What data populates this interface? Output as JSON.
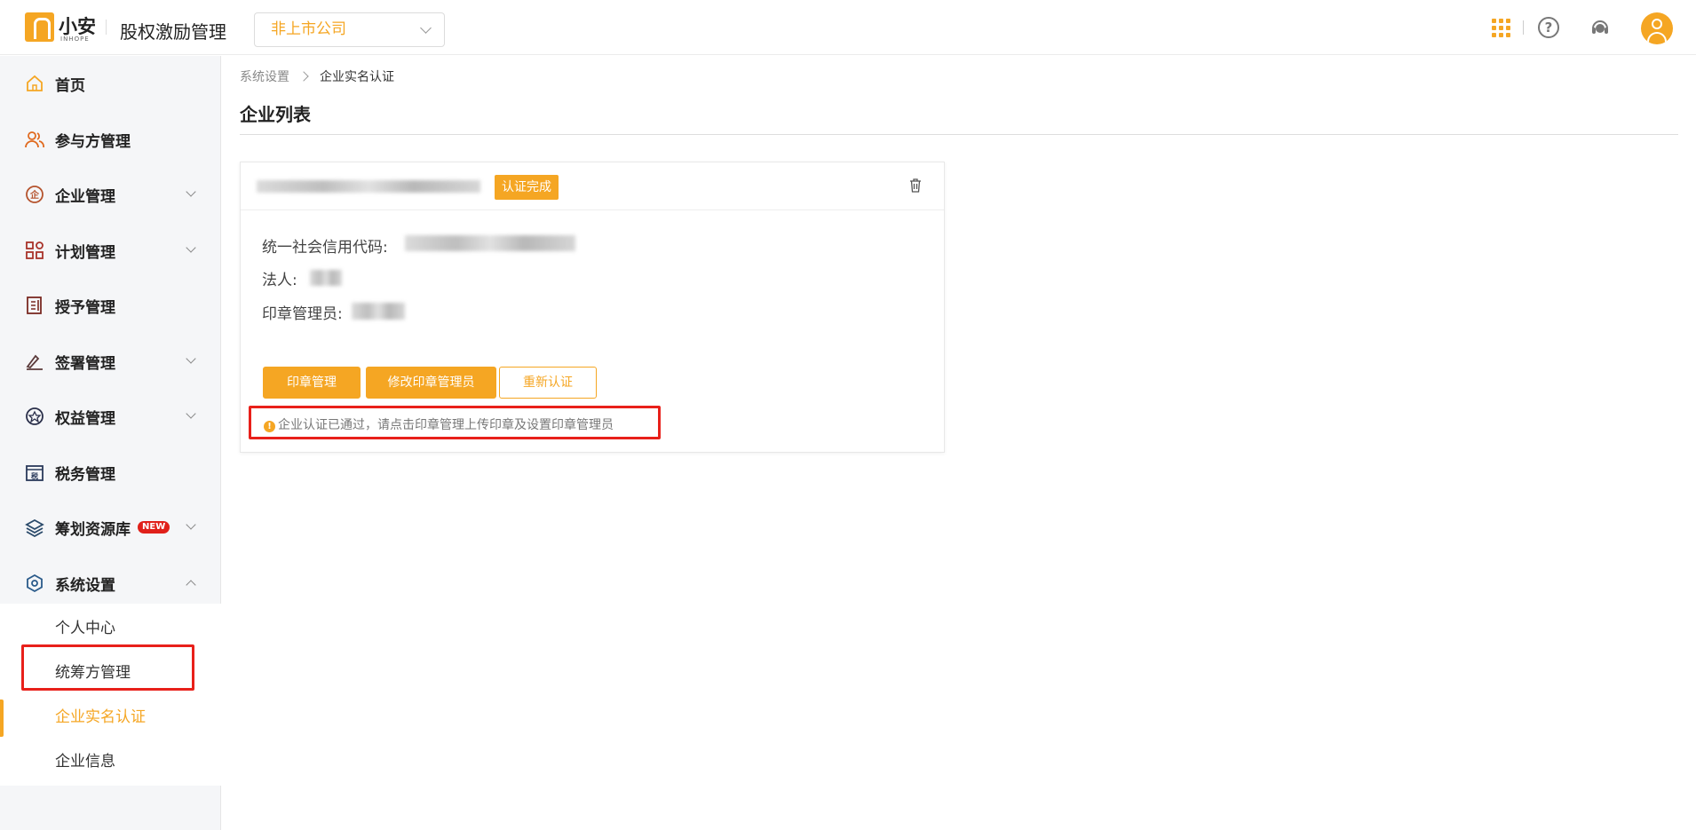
{
  "header": {
    "logo_text": "小安",
    "logo_sub": "INHOPE",
    "app_title": "股权激励管理",
    "company_select": "非上市公司",
    "icons": [
      "apps-grid-icon",
      "help-icon",
      "customer-service-icon",
      "user-avatar"
    ]
  },
  "sidebar": {
    "items": [
      {
        "label": "首页",
        "icon": "home-icon"
      },
      {
        "label": "参与方管理",
        "icon": "users-icon"
      },
      {
        "label": "企业管理",
        "icon": "enterprise-icon"
      },
      {
        "label": "计划管理",
        "icon": "plan-icon"
      },
      {
        "label": "授予管理",
        "icon": "grant-icon"
      },
      {
        "label": "签署管理",
        "icon": "sign-icon"
      },
      {
        "label": "权益管理",
        "icon": "equity-icon"
      },
      {
        "label": "税务管理",
        "icon": "tax-icon"
      },
      {
        "label": "筹划资源库",
        "icon": "layers-icon",
        "badge": "NEW"
      },
      {
        "label": "系统设置",
        "icon": "settings-icon"
      }
    ],
    "sub_items": [
      {
        "label": "个人中心"
      },
      {
        "label": "统筹方管理"
      },
      {
        "label": "企业实名认证"
      },
      {
        "label": "企业信息"
      }
    ]
  },
  "breadcrumb": {
    "parent": "系统设置",
    "current": "企业实名认证"
  },
  "page": {
    "title": "企业列表"
  },
  "card": {
    "status": "认证完成",
    "credit_code_label": "统一社会信用代码:",
    "legal_person_label": "法人:",
    "seal_admin_label": "印章管理员:",
    "buttons": {
      "seal_manage": "印章管理",
      "edit_seal_admin": "修改印章管理员",
      "reauth": "重新认证"
    },
    "notice": "企业认证已通过，请点击印章管理上传印章及设置印章管理员"
  },
  "colors": {
    "accent": "#f5a623",
    "highlight": "#e8201a"
  }
}
